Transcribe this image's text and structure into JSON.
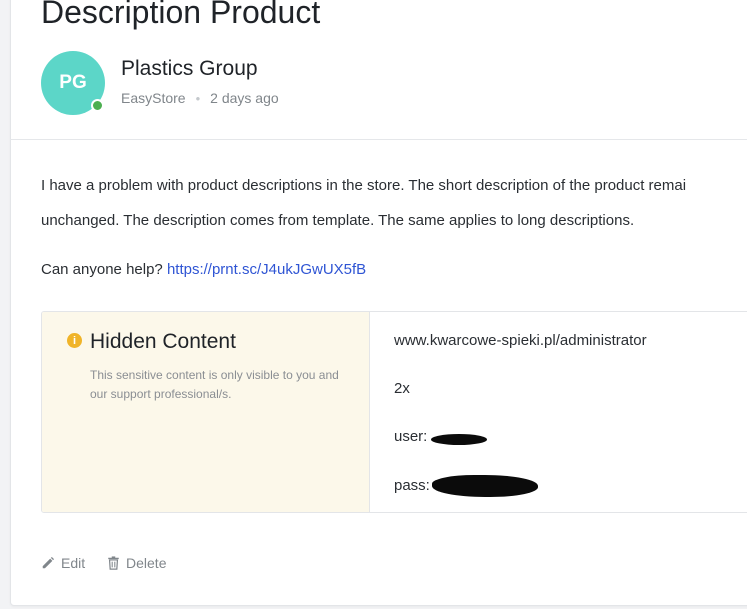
{
  "post": {
    "title": "Description Product",
    "author": {
      "initials": "PG",
      "name": "Plastics Group",
      "status_color": "#4caf50",
      "avatar_color": "#5cd6c8"
    },
    "meta": {
      "category": "EasyStore",
      "separator": "•",
      "time": "2 days ago"
    },
    "body": {
      "line1": "I have a problem with product descriptions in the store. The short description of the product remai",
      "line2": "unchanged. The description comes from template. The same applies to long descriptions.",
      "line3_text": "Can anyone help? ",
      "line3_link": "https://prnt.sc/J4ukJGwUX5fB"
    },
    "hidden_content": {
      "icon": "info-icon",
      "icon_glyph": "i",
      "title": "Hidden Content",
      "note": "This sensitive content is only visible to you and our support professional/s.",
      "lines": {
        "url": "www.kwarcowe-spieki.pl/administrator",
        "count": "2x",
        "user_label": "user:",
        "pass_label": "pass:"
      },
      "colors": {
        "left_bg": "#fcf8ea",
        "icon": "#f0b429"
      }
    },
    "actions": {
      "edit_label": "Edit",
      "edit_icon": "pencil-icon",
      "delete_label": "Delete",
      "delete_icon": "trash-icon"
    }
  }
}
